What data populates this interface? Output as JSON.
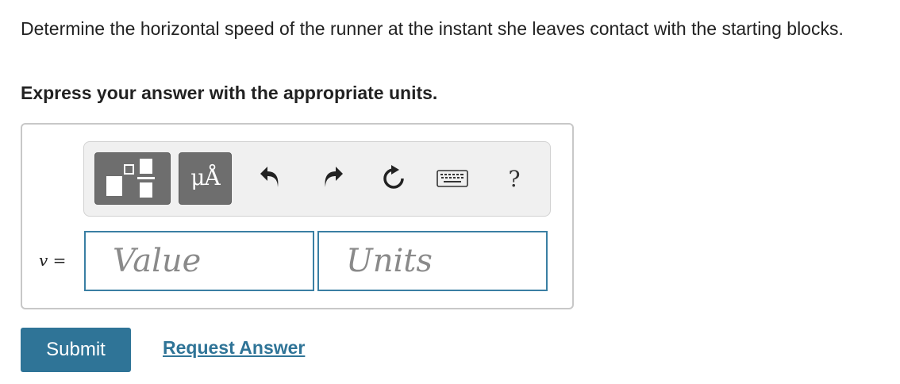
{
  "question": {
    "text": "Determine the horizontal speed of the runner at the instant she leaves contact with the starting blocks.",
    "instruction": "Express your answer with the appropriate units."
  },
  "toolbar": {
    "templates_icon": "templates-icon",
    "units_label": "μÅ",
    "undo_icon": "undo-icon",
    "redo_icon": "redo-icon",
    "reset_icon": "reset-icon",
    "keyboard_icon": "keyboard-icon",
    "help_label": "?"
  },
  "answer": {
    "variable": "v",
    "equals": " =",
    "value_placeholder": "Value",
    "units_placeholder": "Units",
    "value": "",
    "units": ""
  },
  "actions": {
    "submit_label": "Submit",
    "request_label": "Request Answer"
  },
  "colors": {
    "accent": "#2f7497",
    "field_border": "#3a7fa3",
    "toolbar_button": "#6e6e6e"
  }
}
